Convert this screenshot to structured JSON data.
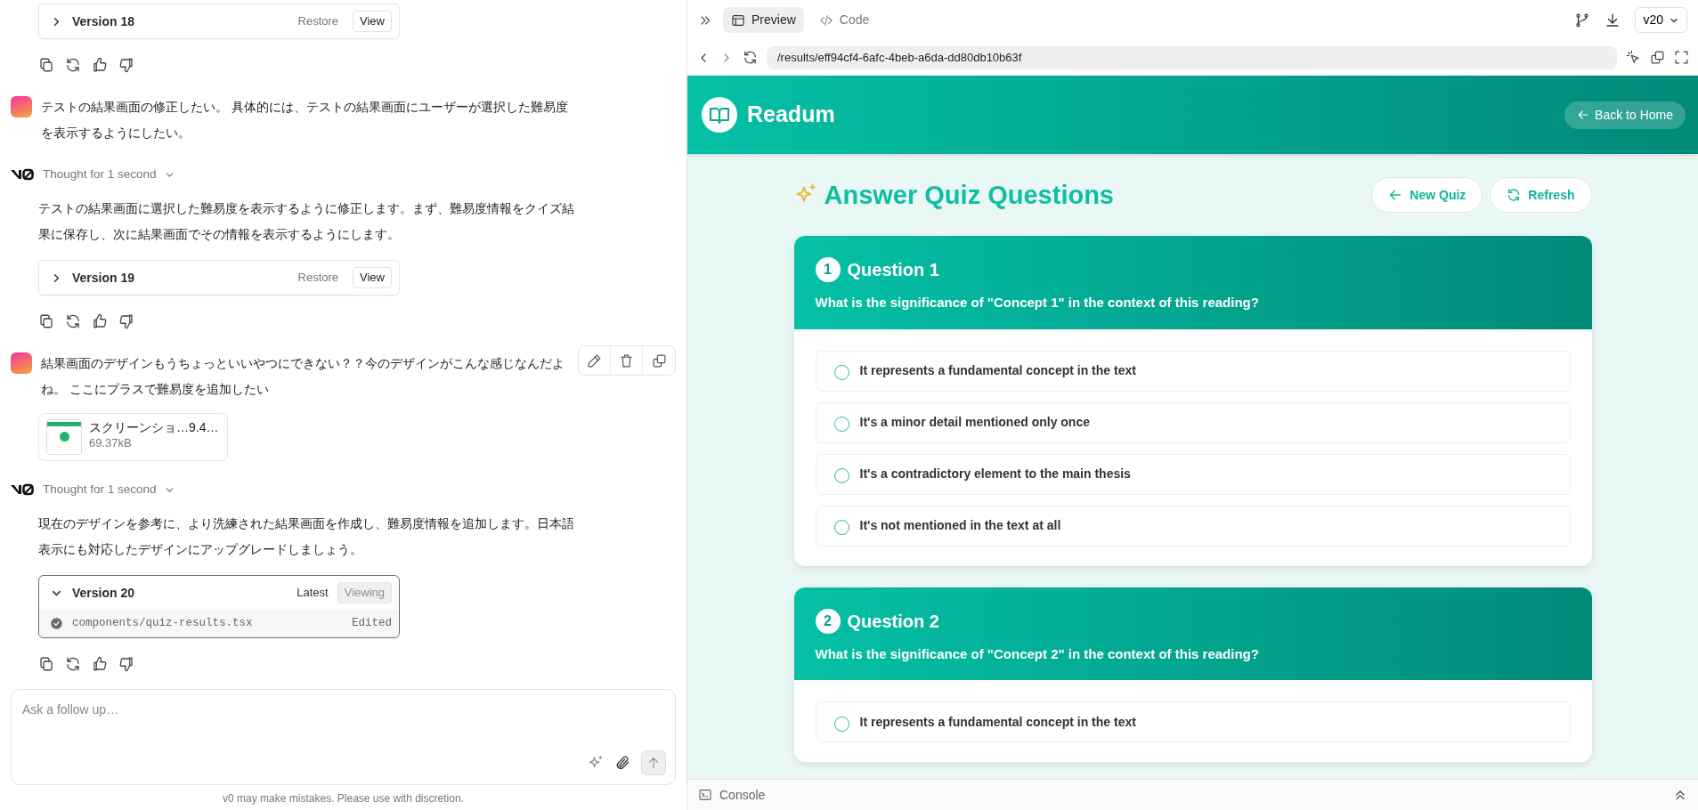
{
  "chat": {
    "messages": [
      {
        "kind": "version",
        "title": "Version 18",
        "expanded": false,
        "actions": [
          "Restore",
          "View"
        ]
      },
      {
        "kind": "feedback"
      },
      {
        "kind": "user",
        "text": "テストの結果画面の修正したい。 具体的には、テストの結果画面にユーザーが選択した難易度を表示するようにしたい。",
        "show_tools": false
      },
      {
        "kind": "thought",
        "label": "Thought for 1 second"
      },
      {
        "kind": "assistant",
        "text": "テストの結果画面に選択した難易度を表示するように修正します。まず、難易度情報をクイズ結果に保存し、次に結果画面でその情報を表示するようにします。"
      },
      {
        "kind": "version",
        "title": "Version 19",
        "expanded": false,
        "actions": [
          "Restore",
          "View"
        ]
      },
      {
        "kind": "feedback"
      },
      {
        "kind": "user",
        "text": "結果画面のデザインもうちょっといいやつにできない？？今のデザインがこんな感じなんだよね。 ここにプラスで難易度を追加したい",
        "show_tools": true,
        "attachment": {
          "name": "スクリーンショ…9.4…",
          "size": "69.37kB"
        }
      },
      {
        "kind": "thought",
        "label": "Thought for 1 second"
      },
      {
        "kind": "assistant",
        "text": "現在のデザインを参考に、より洗練された結果画面を作成し、難易度情報を追加します。日本語表示にも対応したデザインにアップグレードしましょう。"
      },
      {
        "kind": "version",
        "title": "Version 20",
        "expanded": true,
        "status": "Latest",
        "badge": "Viewing",
        "files": [
          {
            "path": "components/quiz-results.tsx",
            "status": "Edited"
          }
        ]
      },
      {
        "kind": "feedback"
      }
    ]
  },
  "composer": {
    "placeholder": "Ask a follow up…",
    "disclaimer": "v0 may make mistakes. Please use with discretion."
  },
  "preview": {
    "tabs": [
      {
        "label": "Preview",
        "selected": true
      },
      {
        "label": "Code",
        "selected": false
      }
    ],
    "version_select": "v20",
    "url": "/results/eff94cf4-6afc-4beb-a6da-dd80db10b63f",
    "app": {
      "brand": "Readum",
      "back": "Back to Home",
      "title": "Answer Quiz Questions",
      "buttons": [
        "New Quiz",
        "Refresh"
      ],
      "questions": [
        {
          "number": "1",
          "title": "Question 1",
          "text": "What is the significance of \"Concept 1\" in the context of this reading?",
          "options": [
            {
              "label": "It represents a fundamental concept in the text",
              "selected": false
            },
            {
              "label": "It's a minor detail mentioned only once",
              "selected": false
            },
            {
              "label": "It's a contradictory element to the main thesis",
              "selected": false
            },
            {
              "label": "It's not mentioned in the text at all",
              "selected": false
            }
          ]
        },
        {
          "number": "2",
          "title": "Question 2",
          "text": "What is the significance of \"Concept 2\" in the context of this reading?",
          "options": [
            {
              "label": "It represents a fundamental concept in the text",
              "selected": false
            }
          ]
        }
      ]
    },
    "console": "Console"
  }
}
